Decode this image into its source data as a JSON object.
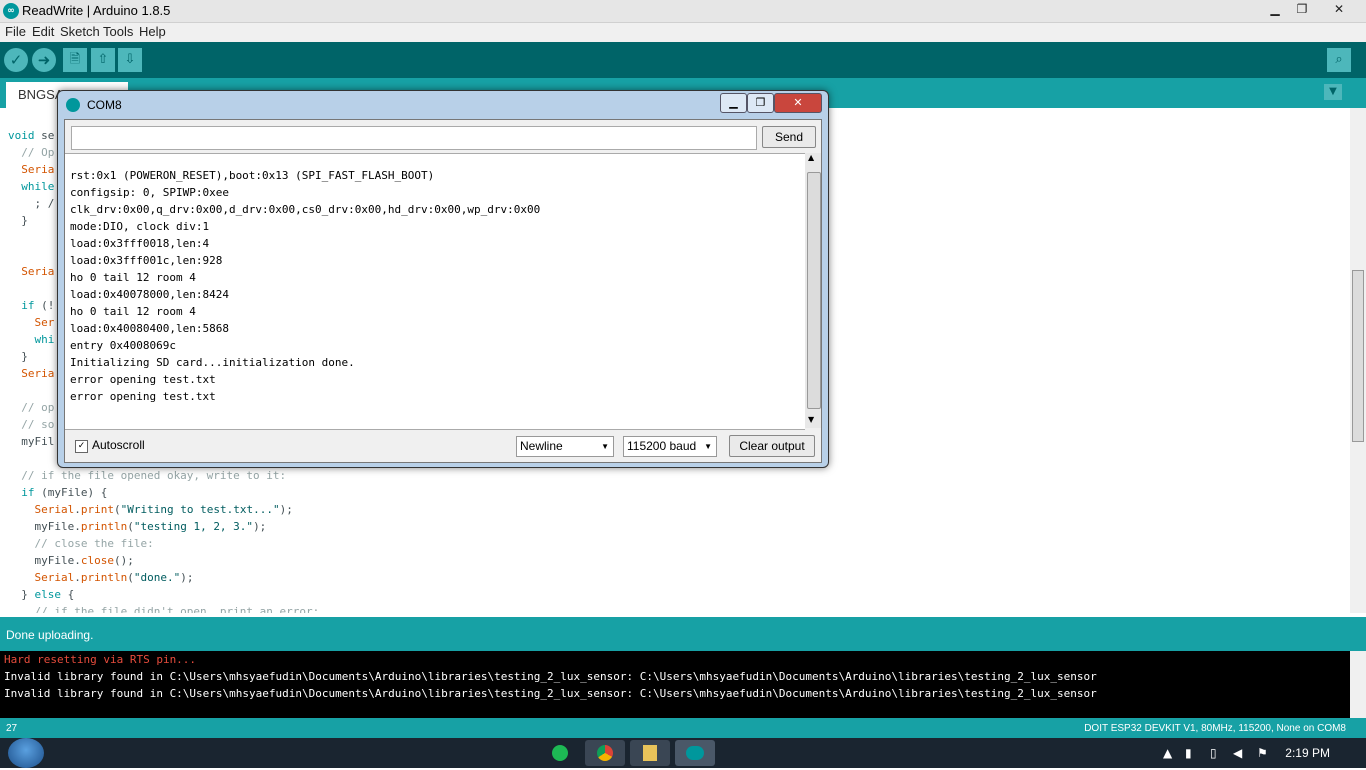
{
  "window": {
    "title": "ReadWrite | Arduino 1.8.5",
    "app_icon": "∞",
    "minimize": "▁",
    "maximize": "❐",
    "close": "✕"
  },
  "menu": [
    "File",
    "Edit",
    "Sketch",
    "Tools",
    "Help"
  ],
  "toolbar": {
    "verify_icon": "✓",
    "upload_icon": "➜",
    "new_icon": "🗎",
    "open_icon": "⇧",
    "save_icon": "⇩",
    "monitor_icon": "⌕",
    "tab_menu_icon": "▼"
  },
  "tab": {
    "label": "BNGSAT..."
  },
  "code_lines": [
    {
      "parts": [
        {
          "c": "kw",
          "t": "void"
        },
        {
          "c": "",
          "t": " se"
        }
      ]
    },
    {
      "parts": [
        {
          "c": "cm",
          "t": "  // Op"
        }
      ]
    },
    {
      "parts": [
        {
          "c": "",
          "t": "  "
        },
        {
          "c": "fn",
          "t": "Seria"
        }
      ]
    },
    {
      "parts": [
        {
          "c": "",
          "t": "  "
        },
        {
          "c": "kw",
          "t": "while"
        }
      ]
    },
    {
      "parts": [
        {
          "c": "",
          "t": "    ; /"
        }
      ]
    },
    {
      "parts": [
        {
          "c": "",
          "t": "  }"
        }
      ]
    },
    {
      "parts": [
        {
          "c": "",
          "t": ""
        }
      ]
    },
    {
      "parts": [
        {
          "c": "",
          "t": ""
        }
      ]
    },
    {
      "parts": [
        {
          "c": "",
          "t": "  "
        },
        {
          "c": "fn",
          "t": "Seria"
        }
      ]
    },
    {
      "parts": [
        {
          "c": "",
          "t": ""
        }
      ]
    },
    {
      "parts": [
        {
          "c": "",
          "t": "  "
        },
        {
          "c": "kw",
          "t": "if"
        },
        {
          "c": "",
          "t": " (!"
        }
      ]
    },
    {
      "parts": [
        {
          "c": "",
          "t": "    "
        },
        {
          "c": "fn",
          "t": "Ser"
        }
      ]
    },
    {
      "parts": [
        {
          "c": "",
          "t": "    "
        },
        {
          "c": "kw",
          "t": "whi"
        }
      ]
    },
    {
      "parts": [
        {
          "c": "",
          "t": "  }"
        }
      ]
    },
    {
      "parts": [
        {
          "c": "",
          "t": "  "
        },
        {
          "c": "fn",
          "t": "Seria"
        }
      ]
    },
    {
      "parts": [
        {
          "c": "",
          "t": ""
        }
      ]
    },
    {
      "parts": [
        {
          "c": "cm",
          "t": "  // op"
        }
      ]
    },
    {
      "parts": [
        {
          "c": "cm",
          "t": "  // so"
        }
      ]
    },
    {
      "parts": [
        {
          "c": "",
          "t": "  myFil"
        }
      ]
    },
    {
      "parts": [
        {
          "c": "",
          "t": ""
        }
      ]
    },
    {
      "parts": [
        {
          "c": "cm",
          "t": "  // if the file opened okay, write to it:"
        }
      ]
    },
    {
      "parts": [
        {
          "c": "",
          "t": "  "
        },
        {
          "c": "kw",
          "t": "if"
        },
        {
          "c": "",
          "t": " (myFile) {"
        }
      ]
    },
    {
      "parts": [
        {
          "c": "",
          "t": "    "
        },
        {
          "c": "fn",
          "t": "Serial"
        },
        {
          "c": "",
          "t": "."
        },
        {
          "c": "fn",
          "t": "print"
        },
        {
          "c": "",
          "t": "("
        },
        {
          "c": "str",
          "t": "\"Writing to test.txt...\""
        },
        {
          "c": "",
          "t": ");"
        }
      ]
    },
    {
      "parts": [
        {
          "c": "",
          "t": "    myFile."
        },
        {
          "c": "fn",
          "t": "println"
        },
        {
          "c": "",
          "t": "("
        },
        {
          "c": "str",
          "t": "\"testing 1, 2, 3.\""
        },
        {
          "c": "",
          "t": ");"
        }
      ]
    },
    {
      "parts": [
        {
          "c": "cm",
          "t": "    // close the file:"
        }
      ]
    },
    {
      "parts": [
        {
          "c": "",
          "t": "    myFile."
        },
        {
          "c": "fn",
          "t": "close"
        },
        {
          "c": "",
          "t": "();"
        }
      ]
    },
    {
      "parts": [
        {
          "c": "",
          "t": "    "
        },
        {
          "c": "fn",
          "t": "Serial"
        },
        {
          "c": "",
          "t": "."
        },
        {
          "c": "fn",
          "t": "println"
        },
        {
          "c": "",
          "t": "("
        },
        {
          "c": "str",
          "t": "\"done.\""
        },
        {
          "c": "",
          "t": ");"
        }
      ]
    },
    {
      "parts": [
        {
          "c": "",
          "t": "  } "
        },
        {
          "c": "kw",
          "t": "else"
        },
        {
          "c": "",
          "t": " {"
        }
      ]
    },
    {
      "parts": [
        {
          "c": "cm",
          "t": "    // if the file didn't open, print an error:"
        }
      ]
    }
  ],
  "status": {
    "text": "Done uploading."
  },
  "console_lines": [
    {
      "color": "#e74c3c",
      "text": "Hard resetting via RTS pin..."
    },
    {
      "color": "#ffffff",
      "text": "Invalid library found in C:\\Users\\mhsyaefudin\\Documents\\Arduino\\libraries\\testing_2_lux_sensor: C:\\Users\\mhsyaefudin\\Documents\\Arduino\\libraries\\testing_2_lux_sensor"
    },
    {
      "color": "#ffffff",
      "text": "Invalid library found in C:\\Users\\mhsyaefudin\\Documents\\Arduino\\libraries\\testing_2_lux_sensor: C:\\Users\\mhsyaefudin\\Documents\\Arduino\\libraries\\testing_2_lux_sensor"
    }
  ],
  "bottom": {
    "line_number": "27",
    "board_info": "DOIT ESP32 DEVKIT V1, 80MHz, 115200, None on COM8"
  },
  "serial_monitor": {
    "title": "COM8",
    "input_value": "",
    "send_label": "Send",
    "output_lines": [
      "",
      "rst:0x1 (POWERON_RESET),boot:0x13 (SPI_FAST_FLASH_BOOT)",
      "configsip: 0, SPIWP:0xee",
      "clk_drv:0x00,q_drv:0x00,d_drv:0x00,cs0_drv:0x00,hd_drv:0x00,wp_drv:0x00",
      "mode:DIO, clock div:1",
      "load:0x3fff0018,len:4",
      "load:0x3fff001c,len:928",
      "ho 0 tail 12 room 4",
      "load:0x40078000,len:8424",
      "ho 0 tail 12 room 4",
      "load:0x40080400,len:5868",
      "entry 0x4008069c",
      "Initializing SD card...initialization done.",
      "error opening test.txt",
      "error opening test.txt"
    ],
    "autoscroll_label": "Autoscroll",
    "autoscroll_checked": "✓",
    "line_ending": "Newline",
    "baud": "115200 baud",
    "clear_label": "Clear output"
  },
  "taskbar": {
    "clock": "2:19 PM",
    "apps": [
      "spotify-icon",
      "chrome-icon",
      "explorer-icon",
      "arduino-icon"
    ]
  },
  "colors": {
    "teal_dark": "#006468",
    "teal": "#17a1a5",
    "keyword": "#00979c",
    "function": "#d35400"
  }
}
